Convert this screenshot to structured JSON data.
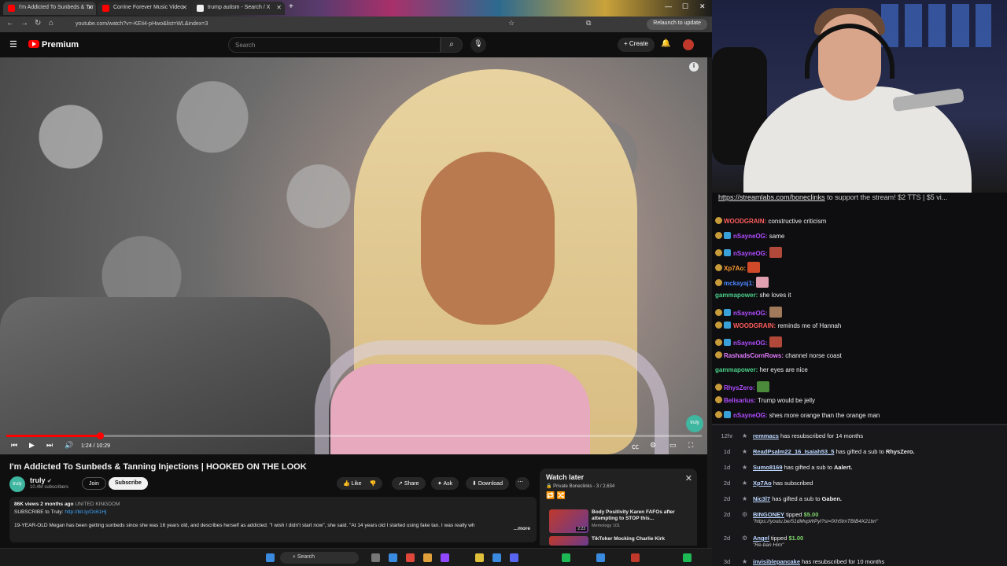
{
  "browser": {
    "tabs": [
      {
        "label": "I'm Addicted To Sunbeds & Tar",
        "color": "#ff0000",
        "active": true
      },
      {
        "label": "Corrine Forever Music Video",
        "color": "#ff0000",
        "active": false
      },
      {
        "label": "trump autism - Search / X",
        "color": "#ffffff",
        "active": false
      }
    ],
    "url": "youtube.com/watch?v=-KEIi4-pHwo&list=WL&index=3",
    "relaunch_label": "Relaunch to update"
  },
  "youtube": {
    "logo_label": "Premium",
    "search_placeholder": "Search",
    "create_label": "Create",
    "video": {
      "title": "I'm Addicted To Sunbeds & Tanning Injections | HOOKED ON THE LOOK",
      "time_current": "1:24",
      "time_total": "10:29",
      "progress": 0.135,
      "watermark": "truly"
    },
    "channel": {
      "name": "truly",
      "subscribers": "10.4M subscribers",
      "join_label": "Join",
      "subscribe_label": "Subscribe"
    },
    "actions": {
      "like": "Like",
      "share": "Share",
      "ask": "Ask",
      "download": "Download",
      "more": "⋯"
    },
    "description": {
      "views": "86K views",
      "ago": "2 months ago",
      "location": "UNITED KINGDOM",
      "subscribe_line": "SUBSCRIBE to Truly:",
      "subscribe_link": "http://bit.ly/Oc61Hj",
      "body": "19-YEAR-OLD Megan has been getting sunbeds since she was 16 years old, and describes herself as addicted. \"I wish I didn't start now\", she said. \"At 14 years old I started using fake tan. I was really wh",
      "more": "...more"
    },
    "watch_later": {
      "title": "Watch later",
      "privacy": "Private",
      "owner": "Boneclinks",
      "position": "3 / 2,634",
      "items": [
        {
          "index": "1",
          "title": "Body Positivity Karen FAFOs after attempting to STOP this...",
          "channel": "Memology 101",
          "duration": "2:23"
        },
        {
          "index": "",
          "title": "TikToker Mocking Charlie Kirk",
          "channel": "",
          "duration": ""
        }
      ]
    }
  },
  "taskbar": {
    "search_label": "Search"
  },
  "stream": {
    "banner_link": "https://streamlabs.com/boneclinks",
    "banner_text": " to support the stream! $2 TTS | $5 vi..."
  },
  "chat": [
    {
      "user": "WOODGRAIN",
      "color": "#ff5d5d",
      "text": "constructive criticism",
      "badges": 1,
      "emote": ""
    },
    {
      "user": "nSayneOG",
      "color": "#b04cff",
      "text": "same",
      "badges": 2,
      "emote": ""
    },
    {
      "user": "nSayneOG",
      "color": "#b04cff",
      "text": "",
      "badges": 2,
      "emote": "#b0493a"
    },
    {
      "user": "Xp7Ao",
      "color": "#ff9b2f",
      "text": "",
      "badges": 1,
      "emote": "#d04a2a"
    },
    {
      "user": "mckayaj1",
      "color": "#4b86ff",
      "text": "",
      "badges": 1,
      "emote": "#e0a0b0"
    },
    {
      "user": "gammapower",
      "color": "#4ad08a",
      "text": "she loves it",
      "badges": 0,
      "emote": ""
    },
    {
      "user": "nSayneOG",
      "color": "#b04cff",
      "text": "",
      "badges": 2,
      "emote": "#a07a5a"
    },
    {
      "user": "WOODGRAIN",
      "color": "#ff5d5d",
      "text": "reminds me of Hannah",
      "badges": 2,
      "emote": ""
    },
    {
      "user": "nSayneOG",
      "color": "#b04cff",
      "text": "",
      "badges": 2,
      "emote": "#b0493a"
    },
    {
      "user": "RashadsCornRows",
      "color": "#e37bff",
      "text": "channel norse coast",
      "badges": 1,
      "emote": ""
    },
    {
      "user": "gammapower",
      "color": "#4ad08a",
      "text": "her eyes are nice",
      "badges": 0,
      "emote": ""
    },
    {
      "user": "RhysZero",
      "color": "#b04cff",
      "text": "",
      "badges": 1,
      "emote": "#4a8a3a"
    },
    {
      "user": "Belisarius",
      "color": "#b04cff",
      "text": "Trump would be jelly",
      "badges": 1,
      "emote": ""
    },
    {
      "user": "nSayneOG",
      "color": "#b04cff",
      "text": "shes more orange than the orange man",
      "badges": 2,
      "emote": ""
    }
  ],
  "events": [
    {
      "time": "12hr",
      "name": "remmacs",
      "text": " has resubscribed for 14 months",
      "amount": "",
      "sub": ""
    },
    {
      "time": "1d",
      "name": "ReadPsalm22_16_Isaiah53_5",
      "text": " has gifted a sub to ",
      "target": "RhysZero.",
      "amount": "",
      "sub": ""
    },
    {
      "time": "1d",
      "name": "Sumo8169",
      "text": " has gifted a sub to ",
      "target": "Aalert.",
      "amount": "",
      "sub": ""
    },
    {
      "time": "2d",
      "name": "Xp7Ao",
      "text": " has subscribed",
      "amount": "",
      "sub": ""
    },
    {
      "time": "2d",
      "name": "Nic3l7",
      "text": " has gifted a sub to ",
      "target": "Gaben.",
      "amount": "",
      "sub": ""
    },
    {
      "time": "2d",
      "name": "BINGONEY",
      "text": " tipped ",
      "amount": "$5.00",
      "sub": "\"https://youtu.be/51dMvpWPyI?si=fXh5tmTBIB4X21bn\""
    },
    {
      "time": "2d",
      "name": "Angel",
      "text": " tipped ",
      "amount": "$1.00",
      "sub": "\"Re-ban Him\""
    },
    {
      "time": "3d",
      "name": "invisiblepancake",
      "text": " has resubscribed for 10 months",
      "amount": "",
      "sub": ""
    }
  ],
  "colors": {
    "accent_red": "#ff0000",
    "page_bg": "#0f0f0f",
    "chat_bg": "#0e0e10"
  }
}
